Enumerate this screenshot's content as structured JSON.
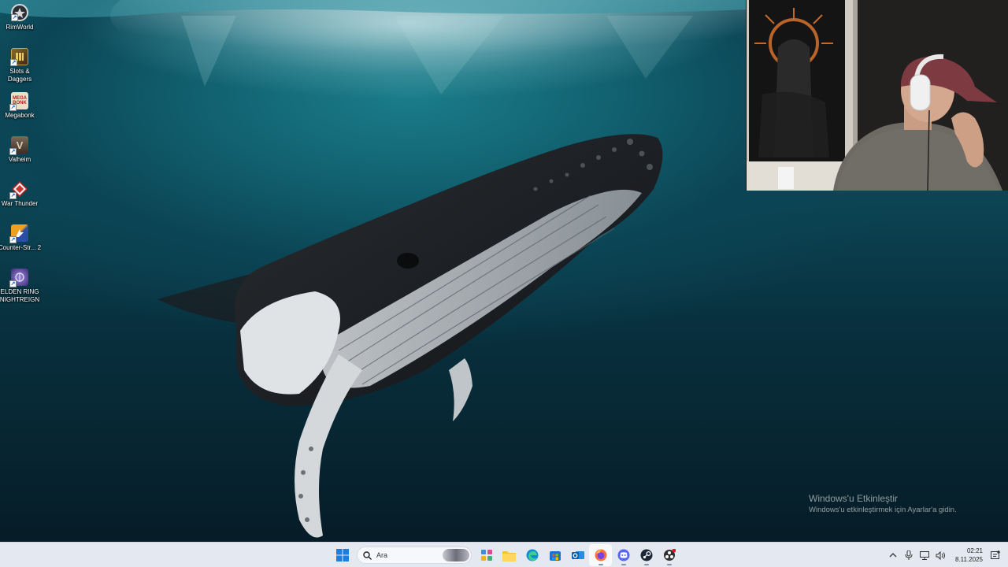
{
  "desktop": {
    "icons": [
      {
        "label": "RimWorld",
        "icon": "rimworld-icon"
      },
      {
        "label": "Slots & Daggers",
        "icon": "slots-daggers-icon"
      },
      {
        "label": "Megabonk",
        "icon": "megabonk-icon",
        "badge": "MEGA BONK"
      },
      {
        "label": "Valheim",
        "icon": "valheim-icon",
        "badge": "V"
      },
      {
        "label": "War Thunder",
        "icon": "war-thunder-icon"
      },
      {
        "label": "Counter-Str... 2",
        "icon": "counter-strike-icon"
      },
      {
        "label": "ELDEN RING NIGHTREIGN",
        "icon": "elden-ring-icon"
      }
    ]
  },
  "watermark": {
    "title": "Windows'u Etkinleştir",
    "subtitle": "Windows'u etkinleştirmek için Ayarlar'a gidin."
  },
  "taskbar": {
    "search_placeholder": "Ara",
    "apps": [
      "start-icon",
      "search-icon",
      "widgets-icon",
      "file-explorer-icon",
      "edge-icon",
      "microsoft-store-icon",
      "outlook-icon",
      "firefox-icon",
      "discord-icon",
      "steam-icon",
      "obs-icon"
    ],
    "tray": {
      "time": "02:21",
      "date": "8.11.2025"
    }
  },
  "colors": {
    "taskbar_bg": "#e4e9f1",
    "ocean_top": "#1a6f7c",
    "ocean_deep": "#061c27"
  }
}
